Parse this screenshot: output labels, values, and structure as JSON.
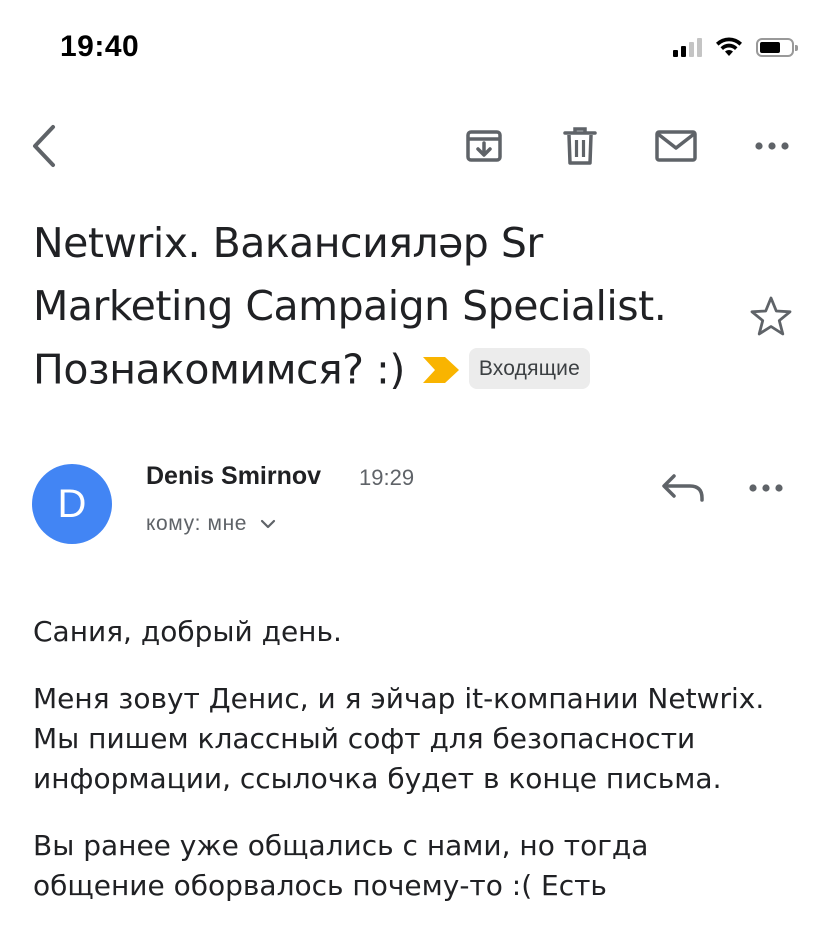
{
  "status_bar": {
    "time": "19:40"
  },
  "toolbar": {
    "back": "back-arrow-icon",
    "archive": "archive-icon",
    "delete": "trash-icon",
    "mark_unread": "mail-icon",
    "more": "more-horizontal-icon"
  },
  "email": {
    "subject": "Netwrix. Вакансияләр Sr Marketing Campaign Specialist. Познакомимся? :)",
    "label": "Входящие",
    "important_color": "#f9b400",
    "sender": {
      "initial": "D",
      "name": "Denis Smirnov",
      "time": "19:29",
      "recipient": "кому: мне",
      "avatar_color": "#4285f4"
    },
    "body": [
      "Сания, добрый день.",
      "Меня зовут Денис, и я эйчар it-компании Netwrix. Мы пишем классный софт для безопасности информации, ссылочка будет в конце письма.",
      "Вы ранее уже общались с нами, но тогда общение оборвалось почему-то :( Есть"
    ]
  }
}
